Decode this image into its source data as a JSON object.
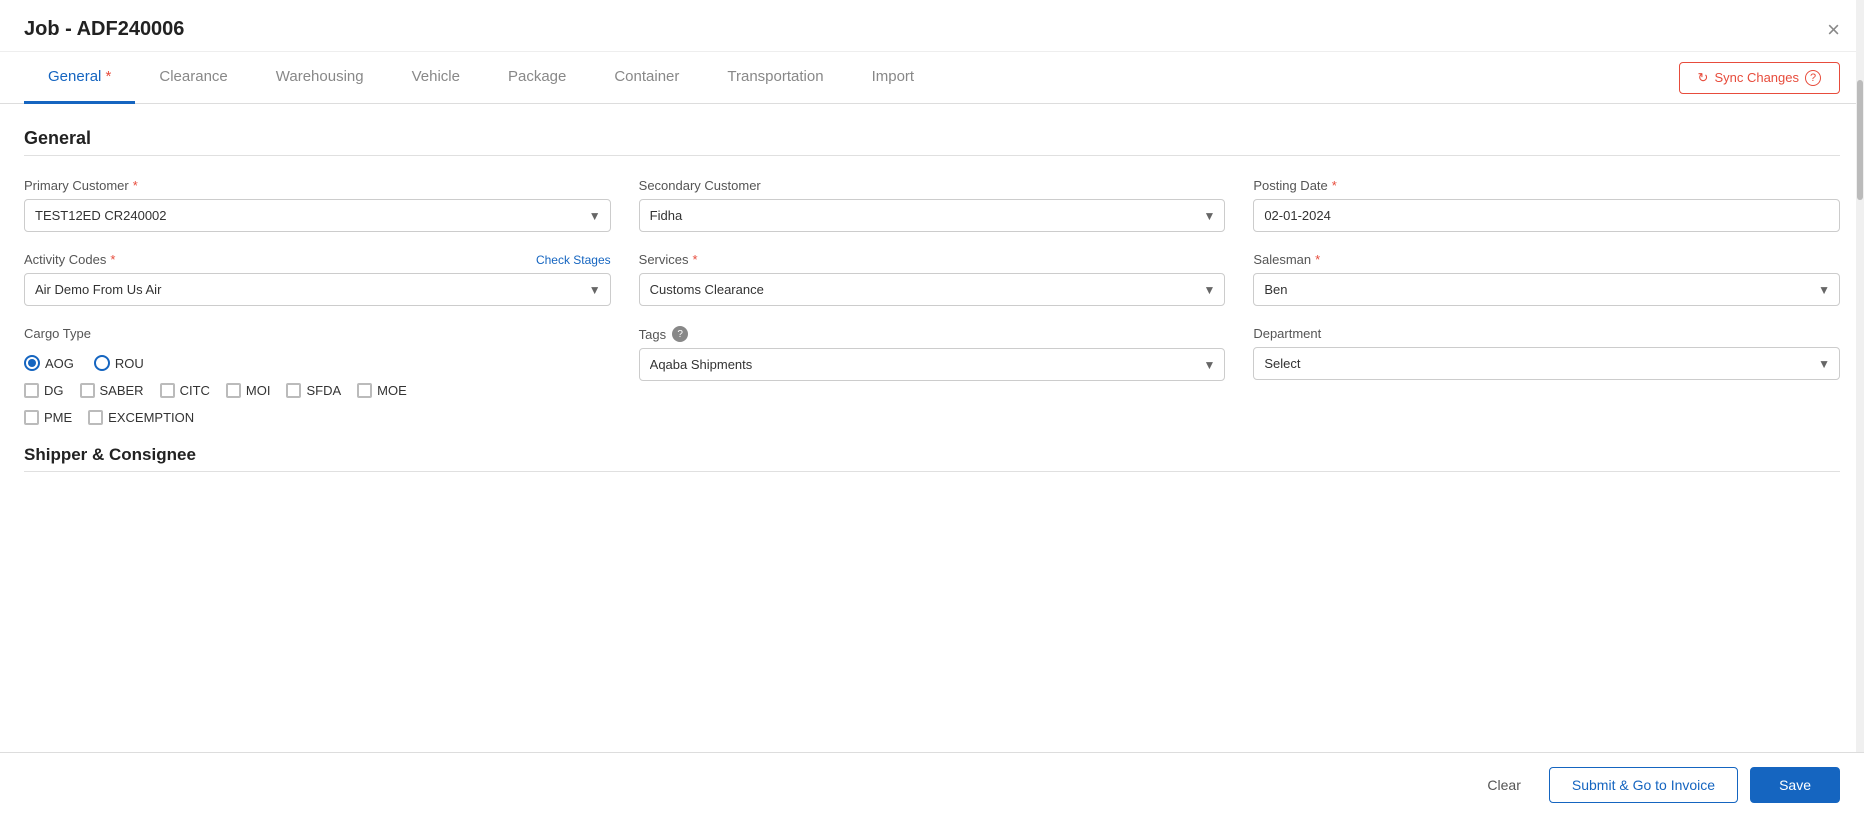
{
  "modal": {
    "title": "Job - ADF240006",
    "close_label": "×"
  },
  "tabs": [
    {
      "id": "general",
      "label": "General",
      "active": true,
      "required": true
    },
    {
      "id": "clearance",
      "label": "Clearance",
      "active": false,
      "required": false
    },
    {
      "id": "warehousing",
      "label": "Warehousing",
      "active": false,
      "required": false
    },
    {
      "id": "vehicle",
      "label": "Vehicle",
      "active": false,
      "required": false
    },
    {
      "id": "package",
      "label": "Package",
      "active": false,
      "required": false
    },
    {
      "id": "container",
      "label": "Container",
      "active": false,
      "required": false
    },
    {
      "id": "transportation",
      "label": "Transportation",
      "active": false,
      "required": false
    },
    {
      "id": "import",
      "label": "Import",
      "active": false,
      "required": false
    }
  ],
  "sync_btn": {
    "label": "Sync Changes",
    "icon": "↻"
  },
  "general_section": {
    "title": "General",
    "fields": {
      "primary_customer": {
        "label": "Primary Customer",
        "required": true,
        "value": "TEST12ED CR240002",
        "placeholder": "Select primary customer"
      },
      "secondary_customer": {
        "label": "Secondary Customer",
        "required": false,
        "value": "Fidha",
        "placeholder": "Select secondary customer"
      },
      "posting_date": {
        "label": "Posting Date",
        "required": true,
        "value": "02-01-2024"
      },
      "activity_codes": {
        "label": "Activity Codes",
        "required": true,
        "check_stages": "Check Stages",
        "value": "Air Demo From Us Air",
        "placeholder": "Select activity codes"
      },
      "services": {
        "label": "Services",
        "required": true,
        "value": "Customs Clearance",
        "placeholder": "Select services"
      },
      "salesman": {
        "label": "Salesman",
        "required": true,
        "value": "Ben",
        "placeholder": "Select salesman"
      },
      "tags": {
        "label": "Tags",
        "has_help": true,
        "value": "Aqaba Shipments",
        "placeholder": "Select tags"
      },
      "department": {
        "label": "Department",
        "required": false,
        "value": "Select",
        "placeholder": "Select department"
      }
    },
    "cargo_type": {
      "label": "Cargo Type",
      "radios": [
        {
          "id": "aog",
          "label": "AOG",
          "checked": true
        },
        {
          "id": "rou",
          "label": "ROU",
          "checked": false
        }
      ],
      "checkboxes": [
        {
          "id": "dg",
          "label": "DG",
          "checked": false
        },
        {
          "id": "saber",
          "label": "SABER",
          "checked": false
        },
        {
          "id": "citc",
          "label": "CITC",
          "checked": false
        },
        {
          "id": "moi",
          "label": "MOI",
          "checked": false
        },
        {
          "id": "sfda",
          "label": "SFDA",
          "checked": false
        },
        {
          "id": "moe",
          "label": "MOE",
          "checked": false
        },
        {
          "id": "pme",
          "label": "PME",
          "checked": false
        },
        {
          "id": "excemption",
          "label": "EXCEMPTION",
          "checked": false
        }
      ]
    }
  },
  "shipper_section": {
    "title": "Shipper & Consignee"
  },
  "footer": {
    "clear_label": "Clear",
    "submit_label": "Submit & Go to Invoice",
    "save_label": "Save"
  }
}
